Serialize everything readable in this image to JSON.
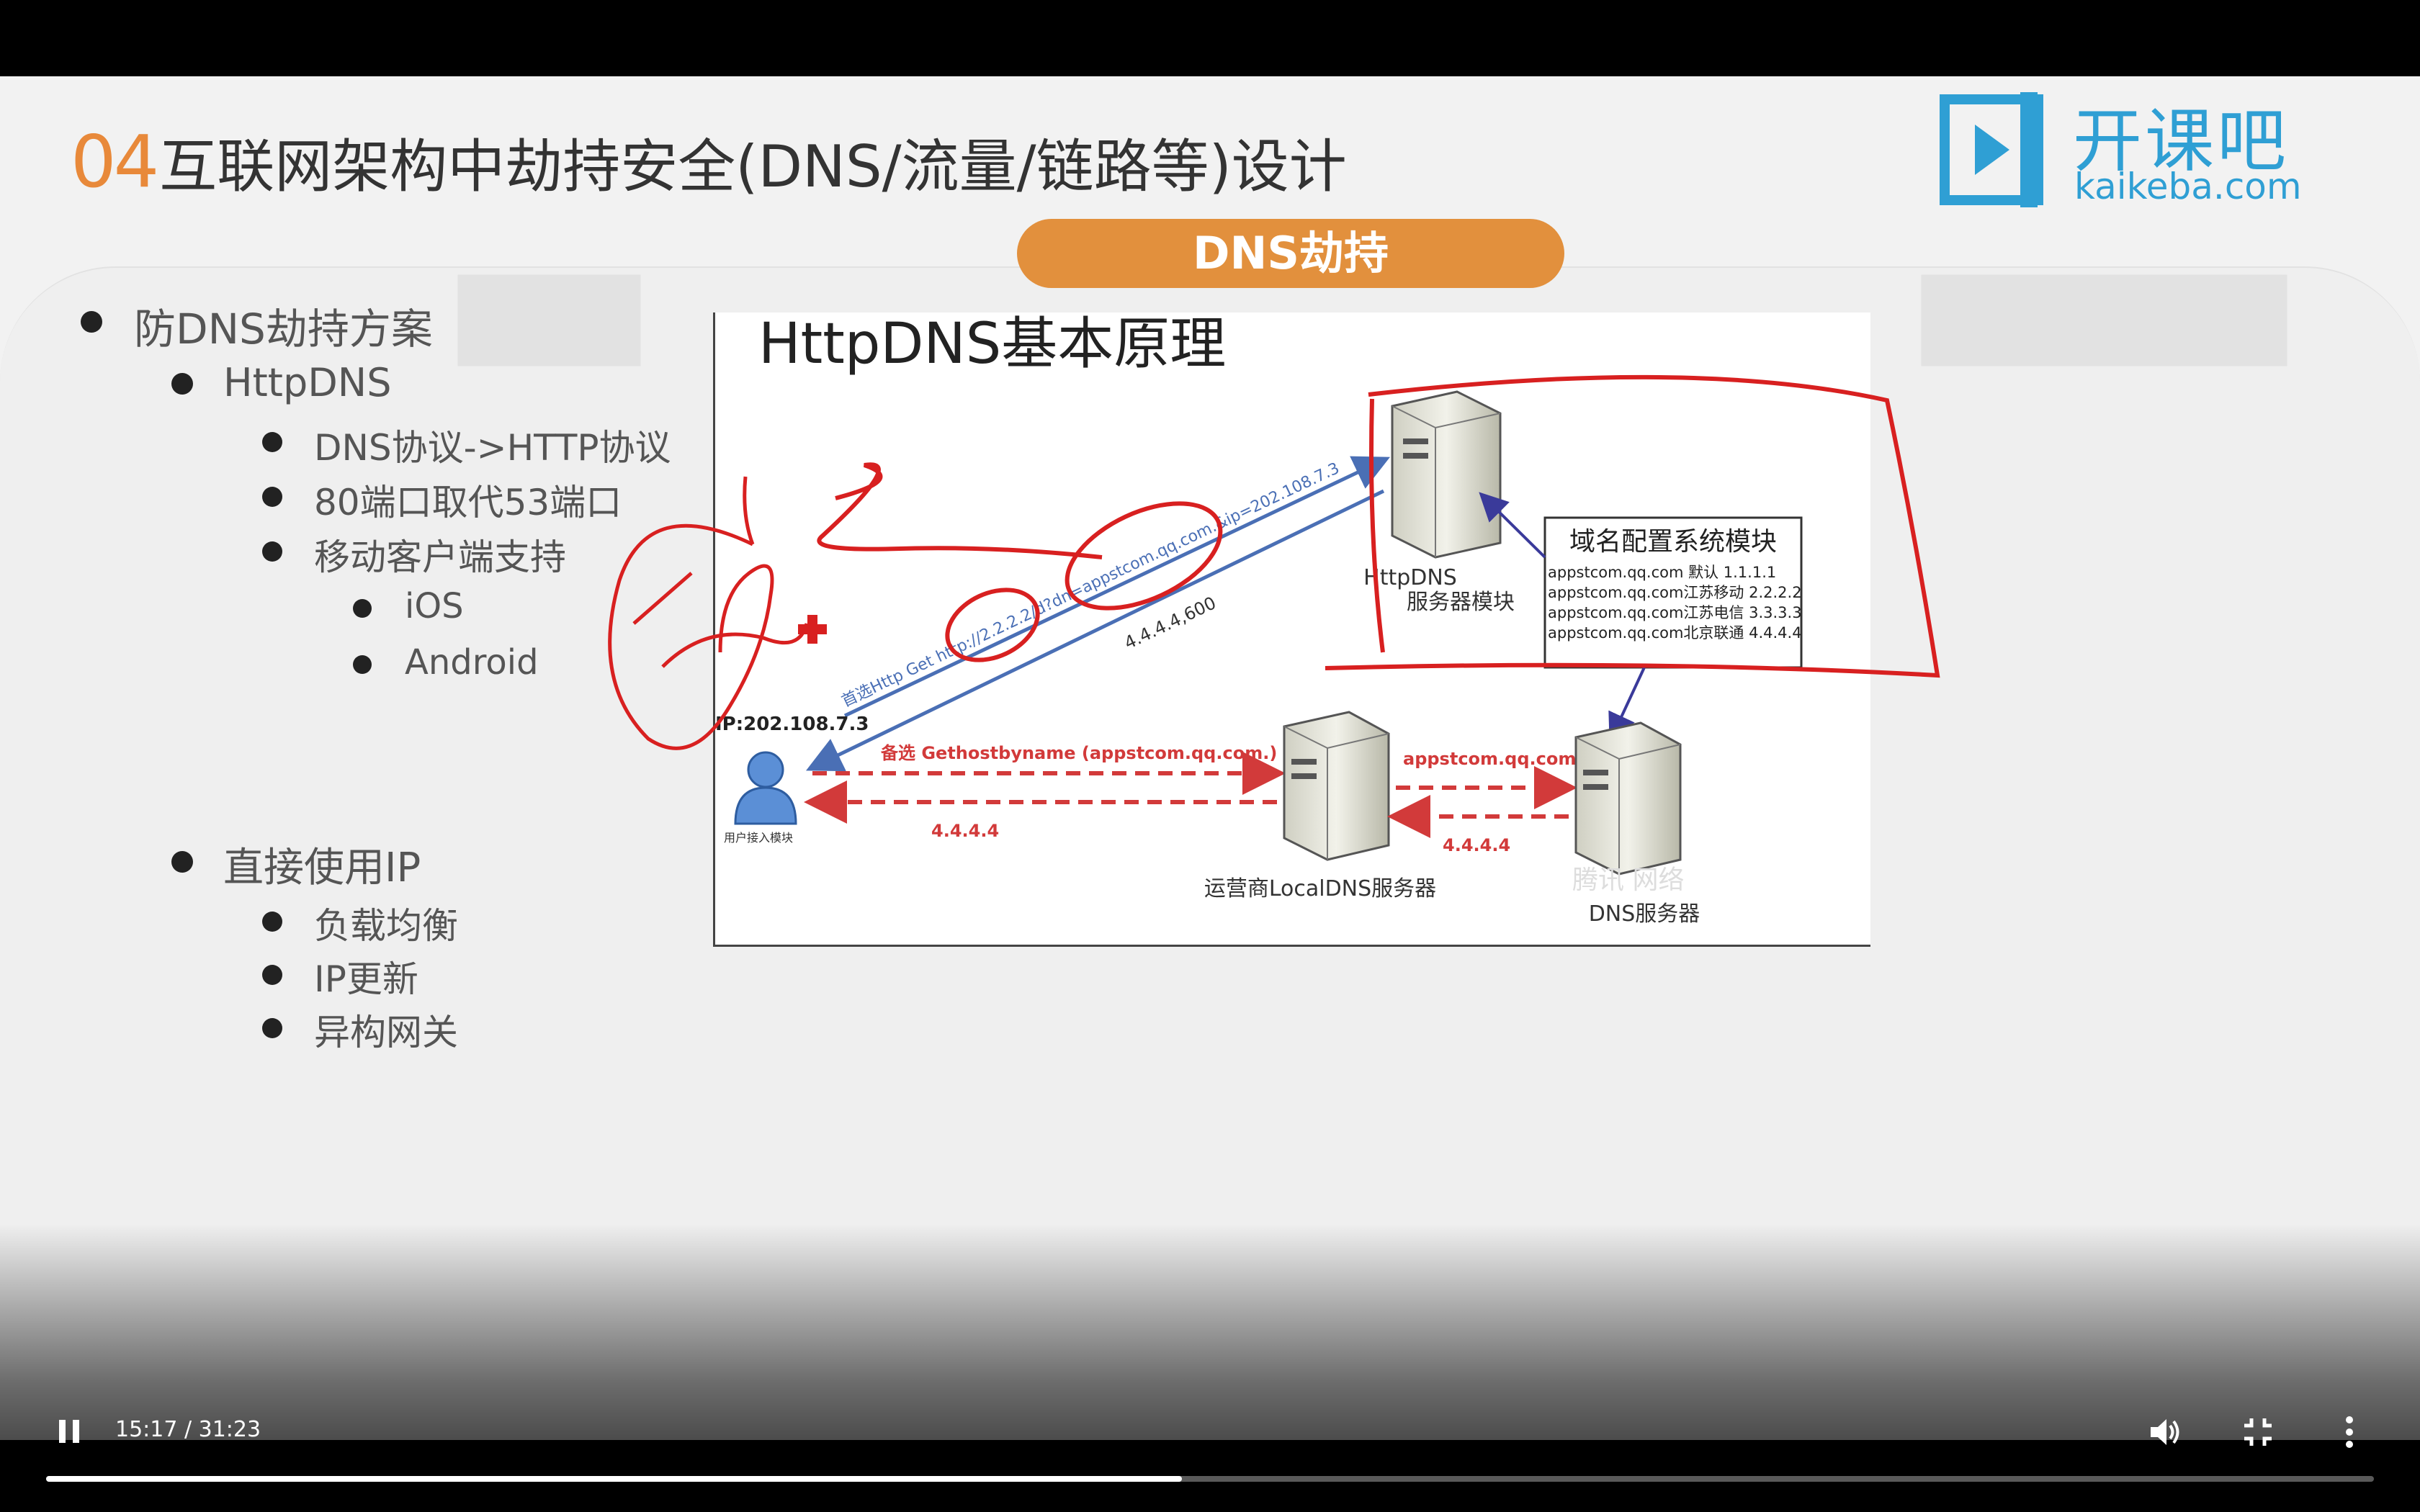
{
  "slide": {
    "title_number": "04",
    "title_text": "互联网架构中劫持安全(DNS/流量/链路等)设计",
    "logo_cn": "开课吧",
    "logo_en": "kaikeba.com",
    "section_pill": "DNS劫持"
  },
  "bullets": {
    "b1": "防DNS劫持方案",
    "b2": "HttpDNS",
    "b3": "DNS协议->HTTP协议",
    "b4": "80端口取代53端口",
    "b5": "移动客户端支持",
    "b6": "iOS",
    "b7": "Android",
    "b8": "直接使用IP",
    "b9": "负载均衡",
    "b10": "IP更新",
    "b11": "异构网关"
  },
  "diagram": {
    "title": "HttpDNS基本原理",
    "httpdns_label_1": "HttpDNS",
    "httpdns_label_2": "服务器模块",
    "config_title": "域名配置系统模块",
    "config_rows": [
      "appstcom.qq.com  默认  1.1.1.1",
      "appstcom.qq.com江苏移动  2.2.2.2",
      "appstcom.qq.com江苏电信  3.3.3.3",
      "appstcom.qq.com北京联通  4.4.4.4"
    ],
    "user_ip": "IP:202.108.7.3",
    "user_label": "用户接入模块",
    "backup_label": "备选 Gethostbyname (appstcom.qq.com.)",
    "left_ip": "4.4.4.4",
    "domain_label": "appstcom.qq.com",
    "right_ip": "4.4.4.4",
    "localdns_label": "运营商LocalDNS服务器",
    "dns_label": "DNS服务器",
    "watermark": "腾讯 网络",
    "http_get": "首选Http Get http://2.2.2.2/d?dn=appstcom.qq.com.&ip=202.108.7.3",
    "ttl": "4.4.4.4,600"
  },
  "player": {
    "time": "15:17 / 31:23",
    "progress": 0.488,
    "icons": [
      "pause-icon",
      "volume-icon",
      "exit-fullscreen-icon",
      "more-icon"
    ]
  }
}
